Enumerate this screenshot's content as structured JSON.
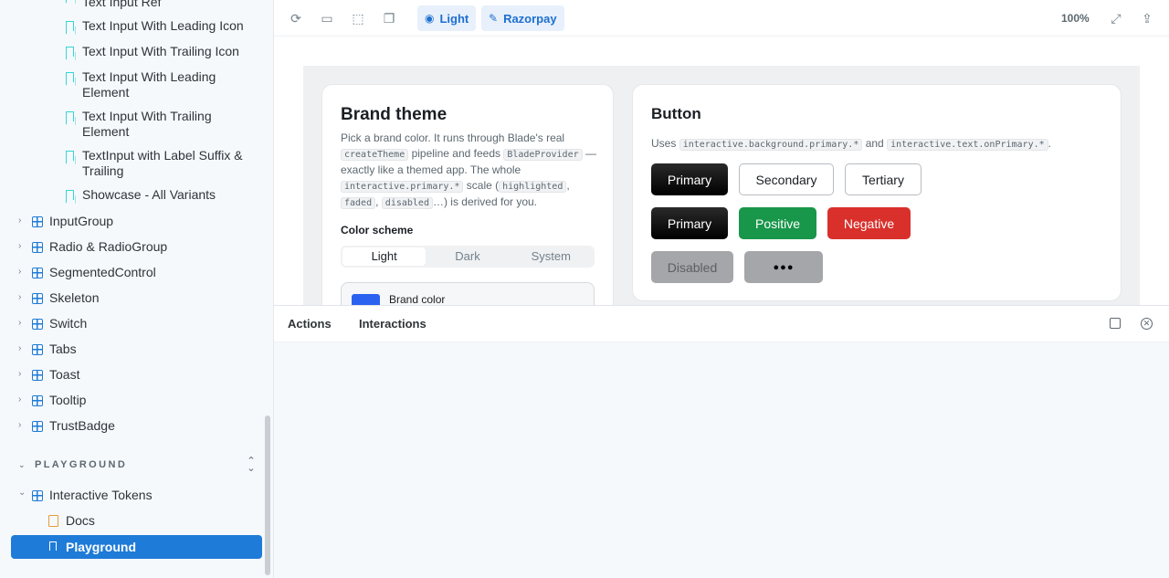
{
  "sidebar": {
    "stories": [
      {
        "label": "Text Input Ref"
      },
      {
        "label": "Text Input With Leading Icon"
      },
      {
        "label": "Text Input With Trailing Icon"
      },
      {
        "label": "Text Input With Leading Element"
      },
      {
        "label": "Text Input With Trailing Element"
      },
      {
        "label": "TextInput with Label Suffix & Trailing"
      },
      {
        "label": "Showcase - All Variants"
      }
    ],
    "components": [
      {
        "label": "InputGroup"
      },
      {
        "label": "Radio & RadioGroup"
      },
      {
        "label": "SegmentedControl"
      },
      {
        "label": "Skeleton"
      },
      {
        "label": "Switch"
      },
      {
        "label": "Tabs"
      },
      {
        "label": "Toast"
      },
      {
        "label": "Tooltip"
      },
      {
        "label": "TrustBadge"
      }
    ],
    "section": "PLAYGROUND",
    "group": "Interactive Tokens",
    "doc": "Docs",
    "active": "Playground"
  },
  "toolbar": {
    "theme_label": "Light",
    "brand_label": "Razorpay",
    "zoom": "100%"
  },
  "brand_card": {
    "title": "Brand theme",
    "desc_1": "Pick a brand color. It runs through Blade's real",
    "code_1": "createTheme",
    "desc_2": "pipeline and feeds",
    "code_2": "BladeProvider",
    "desc_3": "— exactly like a themed app. The whole",
    "code_3": "interactive.primary.*",
    "desc_4": "scale (",
    "code_4": "highlighted",
    "desc_5": ",",
    "code_5": "faded",
    "desc_6": ",",
    "code_6": "disabled",
    "desc_7": "…) is derived for you.",
    "scheme_label": "Color scheme",
    "scheme_options": [
      "Light",
      "Dark",
      "System"
    ],
    "brand_color_label": "Brand color",
    "brand_color": "#2b63f0"
  },
  "button_card": {
    "title": "Button",
    "uses": "Uses",
    "code_1": "interactive.background.primary.*",
    "and": "and",
    "code_2": "interactive.text.onPrimary.*",
    "period": ".",
    "row1": [
      "Primary",
      "Secondary",
      "Tertiary"
    ],
    "row2": [
      "Primary",
      "Positive",
      "Negative"
    ],
    "disabled_label": "Disabled",
    "loading_label": "●●●"
  },
  "addons": {
    "tabs": [
      "Actions",
      "Interactions"
    ]
  }
}
